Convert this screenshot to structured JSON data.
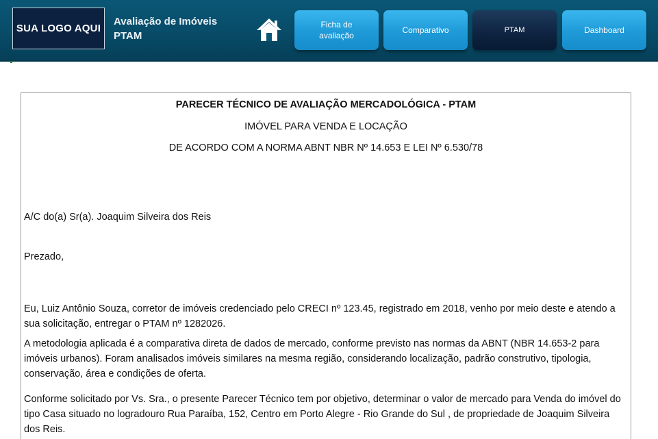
{
  "header": {
    "logo_text": "SUA LOGO AQUI",
    "title_line1": "Avaliação de Imóveis",
    "title_line2": "PTAM",
    "home_icon": "home-icon",
    "colors": {
      "header_bg": "#0a5775",
      "button": "#1f9ad8",
      "button_active": "#0e2340",
      "logo_bg": "#0c2140"
    }
  },
  "nav": {
    "ficha_line1": "Ficha de",
    "ficha_line2": "avaliação",
    "comparativo": "Comparativo",
    "ptam": "PTAM",
    "dashboard": "Dashboard",
    "active": "PTAM"
  },
  "document": {
    "title": "PARECER TÉCNICO DE AVALIAÇÃO MERCADOLÓGICA - PTAM",
    "subtitle": "IMÓVEL PARA VENDA E LOCAÇÃO",
    "norm": "DE ACORDO COM A NORMA ABNT NBR Nº 14.653 E LEI Nº 6.530/78",
    "recipient": "A/C do(a) Sr(a). Joaquim Silveira dos Reis",
    "greeting": "Prezado,",
    "para1": "Eu, Luiz Antônio Souza, corretor de imóveis credenciado pelo CRECI nº 123.45, registrado em 2018, venho por meio deste e atendo a sua solicitação, entregar o PTAM nº 1282026.",
    "para2": "A metodologia aplicada é a comparativa direta de dados de mercado, conforme previsto nas normas da ABNT (NBR 14.653-2 para imóveis urbanos). Foram analisados imóveis similares na mesma região, considerando localização, padrão construtivo, tipologia, conservação, área e condições de oferta.",
    "para3": "Conforme solicitado por Vs. Sra., o presente Parecer Técnico tem por objetivo, determinar o valor de mercado para Venda do imóvel do tipo Casa situado no logradouro Rua Paraíba, 152, Centro em Porto Alegre - Rio Grande do Sul , de propriedade de Joaquim Silveira dos Reis."
  }
}
